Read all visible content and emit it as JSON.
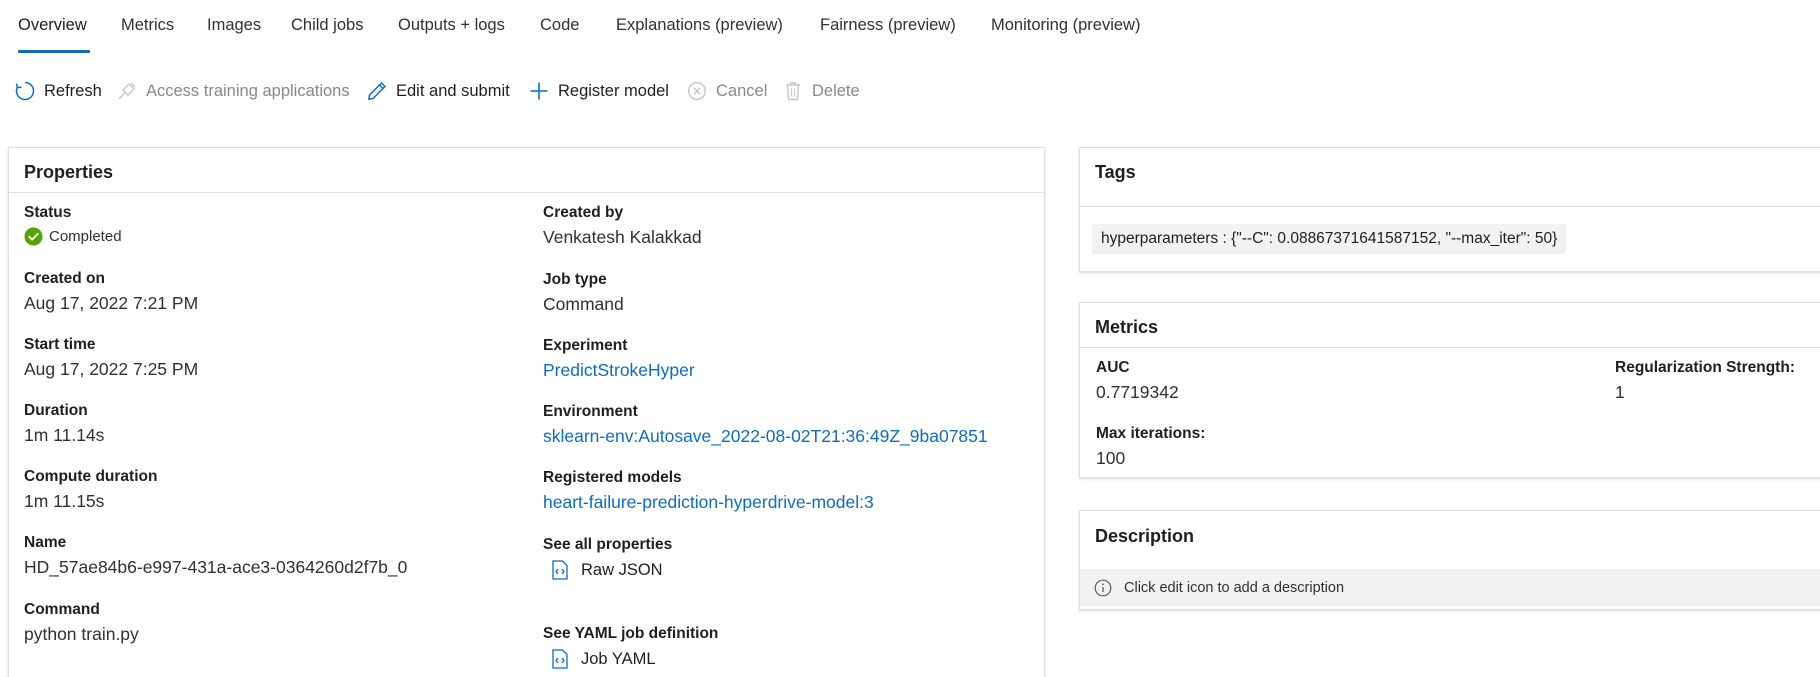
{
  "tabs": [
    {
      "label": "Overview",
      "active": true
    },
    {
      "label": "Metrics"
    },
    {
      "label": "Images"
    },
    {
      "label": "Child jobs"
    },
    {
      "label": "Outputs + logs"
    },
    {
      "label": "Code"
    },
    {
      "label": "Explanations (preview)"
    },
    {
      "label": "Fairness (preview)"
    },
    {
      "label": "Monitoring (preview)"
    }
  ],
  "toolbar": {
    "refresh": "Refresh",
    "access_training": "Access training applications",
    "edit_submit": "Edit and submit",
    "register_model": "Register model",
    "cancel": "Cancel",
    "delete": "Delete"
  },
  "properties": {
    "title": "Properties",
    "status_label": "Status",
    "status_value": "Completed",
    "created_on_label": "Created on",
    "created_on_value": "Aug 17, 2022 7:21 PM",
    "start_time_label": "Start time",
    "start_time_value": "Aug 17, 2022 7:25 PM",
    "duration_label": "Duration",
    "duration_value": "1m 11.14s",
    "compute_duration_label": "Compute duration",
    "compute_duration_value": "1m 11.15s",
    "name_label": "Name",
    "name_value": "HD_57ae84b6-e997-431a-ace3-0364260d2f7b_0",
    "command_label": "Command",
    "command_value": "python train.py",
    "created_by_label": "Created by",
    "created_by_value": "Venkatesh Kalakkad",
    "job_type_label": "Job type",
    "job_type_value": "Command",
    "experiment_label": "Experiment",
    "experiment_value": "PredictStrokeHyper",
    "environment_label": "Environment",
    "environment_value": "sklearn-env:Autosave_2022-08-02T21:36:49Z_9ba07851",
    "registered_models_label": "Registered models",
    "registered_models_value": "heart-failure-prediction-hyperdrive-model:3",
    "see_all_label": "See all properties",
    "raw_json": "Raw JSON",
    "see_yaml_label": "See YAML job definition",
    "job_yaml": "Job YAML"
  },
  "tags": {
    "title": "Tags",
    "chip": "hyperparameters : {\"--C\": 0.08867371641587152, \"--max_iter\": 50}"
  },
  "metrics": {
    "title": "Metrics",
    "auc_label": "AUC",
    "auc_value": "0.7719342",
    "reg_label": "Regularization Strength:",
    "reg_value": "1",
    "max_iter_label": "Max iterations:",
    "max_iter_value": "100"
  },
  "description": {
    "title": "Description",
    "placeholder": "Click edit icon to add a description"
  },
  "colors": {
    "accent": "#0f6cbd",
    "success": "#57a300",
    "disabled": "#8a8886"
  },
  "icons": {
    "refresh": "refresh-icon",
    "access_training": "plug-icon",
    "edit_submit": "pencil-icon",
    "register_model": "plus-icon",
    "cancel": "cancel-circle-icon",
    "delete": "trash-icon",
    "status": "check-circle-icon",
    "file": "code-file-icon",
    "info": "info-icon"
  }
}
